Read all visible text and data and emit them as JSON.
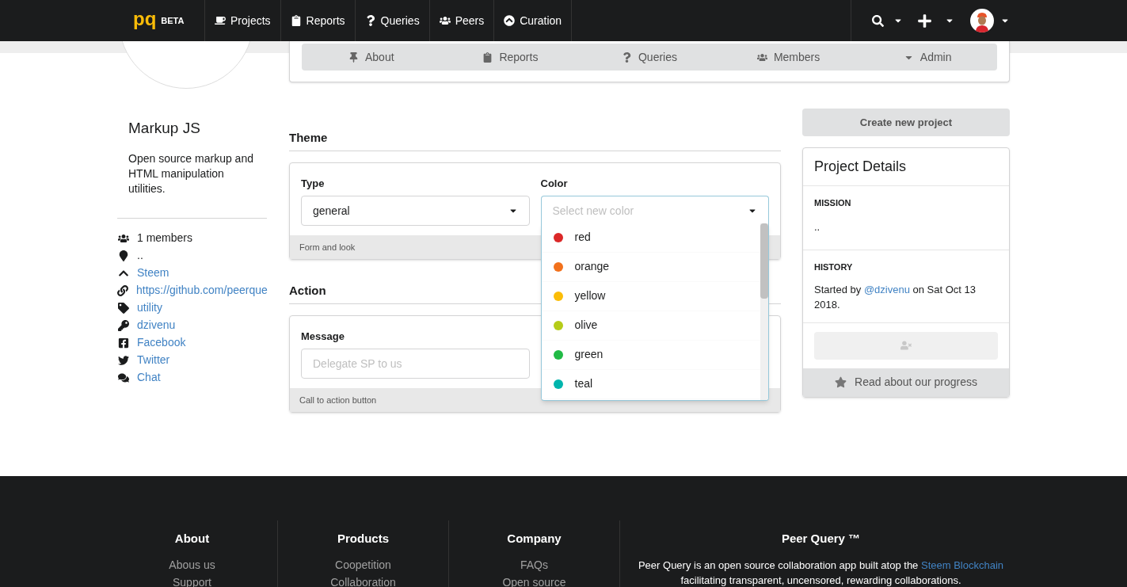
{
  "navbar": {
    "logo": "pq",
    "badge": "BETA",
    "items": [
      {
        "kind": "cup",
        "label": "Projects"
      },
      {
        "kind": "clipboard",
        "label": "Reports"
      },
      {
        "kind": "question",
        "label": "Queries"
      },
      {
        "kind": "users",
        "label": "Peers"
      },
      {
        "kind": "chevron-up",
        "label": "Curation"
      }
    ]
  },
  "project_tabs": [
    {
      "kind": "pin",
      "label": "About"
    },
    {
      "kind": "clipboard",
      "label": "Reports"
    },
    {
      "kind": "question",
      "label": "Queries"
    },
    {
      "kind": "users",
      "label": "Members"
    },
    {
      "kind": "caret",
      "label": "Admin"
    }
  ],
  "sidebar": {
    "title": "Markup JS",
    "description": "Open source markup and HTML manipulation utilities.",
    "facts": [
      {
        "kind": "users",
        "text": "1 members",
        "link": false
      },
      {
        "kind": "marker",
        "text": "..",
        "link": false
      },
      {
        "kind": "chevron-up",
        "text": "Steem",
        "link": true
      },
      {
        "kind": "link",
        "text": "https://github.com/peerque",
        "link": true
      },
      {
        "kind": "tag",
        "text": "utility",
        "link": true
      },
      {
        "kind": "key",
        "text": "dzivenu",
        "link": true
      },
      {
        "kind": "facebook",
        "text": "Facebook",
        "link": true
      },
      {
        "kind": "twitter",
        "text": "Twitter",
        "link": true
      },
      {
        "kind": "comments",
        "text": "Chat",
        "link": true
      }
    ]
  },
  "theme": {
    "title": "Theme",
    "type_field": {
      "label": "Type",
      "value": "general"
    },
    "color_field": {
      "label": "Color",
      "placeholder": "Select new color",
      "expanded": true,
      "options": [
        {
          "name": "red",
          "color": "#db2828"
        },
        {
          "name": "orange",
          "color": "#f2711c"
        },
        {
          "name": "yellow",
          "color": "#fbbd08"
        },
        {
          "name": "olive",
          "color": "#b5cc18"
        },
        {
          "name": "green",
          "color": "#21ba45"
        },
        {
          "name": "teal",
          "color": "#00b5ad"
        }
      ]
    },
    "footer": "Form and look"
  },
  "action": {
    "title": "Action",
    "message_field": {
      "label": "Message",
      "placeholder": "Delegate SP to us"
    },
    "footer": "Call to action button"
  },
  "create_button": "Create new project",
  "details": {
    "title": "Project Details",
    "mission_label": "MISSION",
    "mission": "..",
    "history_label": "HISTORY",
    "history_prefix": "Started by",
    "history_link": "@dzivenu",
    "history_suffix": "on Sat Oct 13 2018.",
    "leave_button": {
      "disabled": true
    },
    "progress_link": "Read about our progress"
  },
  "footer": {
    "columns": [
      {
        "title": "About",
        "links": [
          "Abous us",
          "Support"
        ]
      },
      {
        "title": "Products",
        "links": [
          "Coopetition",
          "Collaboration"
        ]
      },
      {
        "title": "Company",
        "links": [
          "FAQs",
          "Open source"
        ]
      }
    ],
    "about": {
      "title": "Peer Query ™",
      "text_before": "Peer Query is an open source collaboration app built atop the",
      "link": "Steem Blockchain",
      "text_after": "facilitating transparent, uncensored, rewarding collaborations."
    }
  }
}
